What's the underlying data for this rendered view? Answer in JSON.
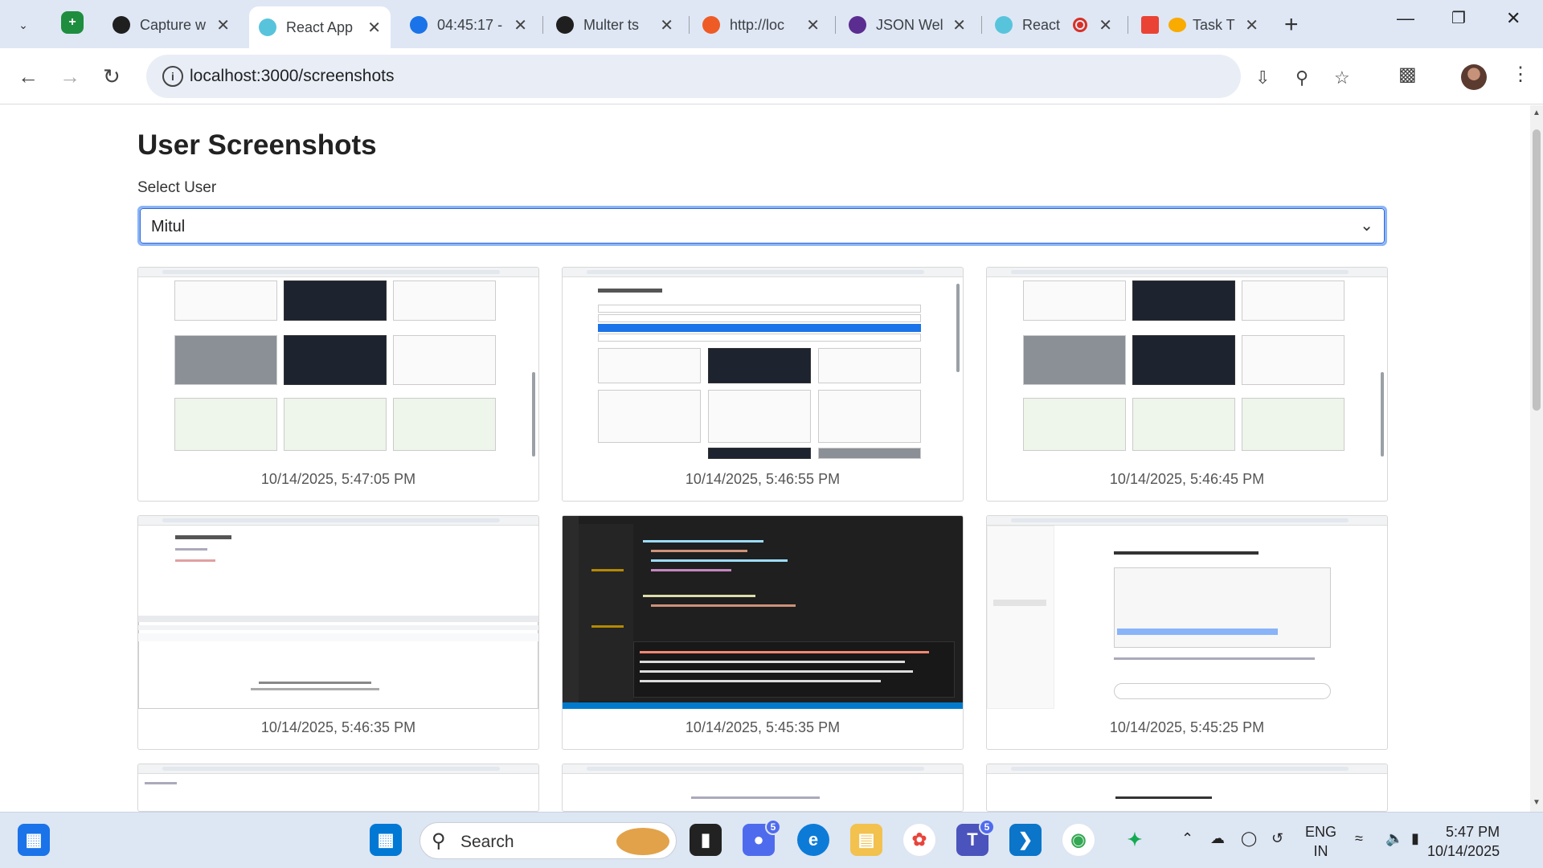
{
  "browser": {
    "tabs": [
      {
        "title": "Capture w",
        "favicon_color": "#1f1f1f",
        "icon": "openai-icon"
      },
      {
        "title": "React App",
        "favicon_color": "#58c4dc",
        "icon": "react-icon",
        "active": true
      },
      {
        "title": "04:45:17 -",
        "favicon_color": "#1a73e8",
        "icon": "clock-icon"
      },
      {
        "title": "Multer ts",
        "favicon_color": "#1f1f1f",
        "icon": "openai-icon"
      },
      {
        "title": "http://loc",
        "favicon_color": "#ef5b25",
        "icon": "postman-icon"
      },
      {
        "title": "JSON Wel",
        "favicon_color": "#5b2d91",
        "icon": "json-icon"
      },
      {
        "title": "React",
        "favicon_color": "#58c4dc",
        "icon": "react-icon",
        "recording": true
      },
      {
        "title": "Task T",
        "favicon_color": "#ea4335",
        "icon": "gmail-icon"
      }
    ],
    "url": "localhost:3000/screenshots"
  },
  "page": {
    "title": "User Screenshots",
    "select_label": "Select User",
    "selected_user": "Mitul",
    "screenshots": [
      {
        "timestamp": "10/14/2025, 5:47:05 PM",
        "kind": "grid"
      },
      {
        "timestamp": "10/14/2025, 5:46:55 PM",
        "kind": "dropdown"
      },
      {
        "timestamp": "10/14/2025, 5:46:45 PM",
        "kind": "grid"
      },
      {
        "timestamp": "10/14/2025, 5:46:35 PM",
        "kind": "devtools"
      },
      {
        "timestamp": "10/14/2025, 5:45:35 PM",
        "kind": "editor"
      },
      {
        "timestamp": "10/14/2025, 5:45:25 PM",
        "kind": "chat"
      }
    ]
  },
  "taskbar": {
    "search_placeholder": "Search",
    "language": "ENG",
    "region": "IN",
    "time": "5:47 PM",
    "date": "10/14/2025",
    "badges": {
      "teams": "5",
      "chat": "5"
    }
  }
}
